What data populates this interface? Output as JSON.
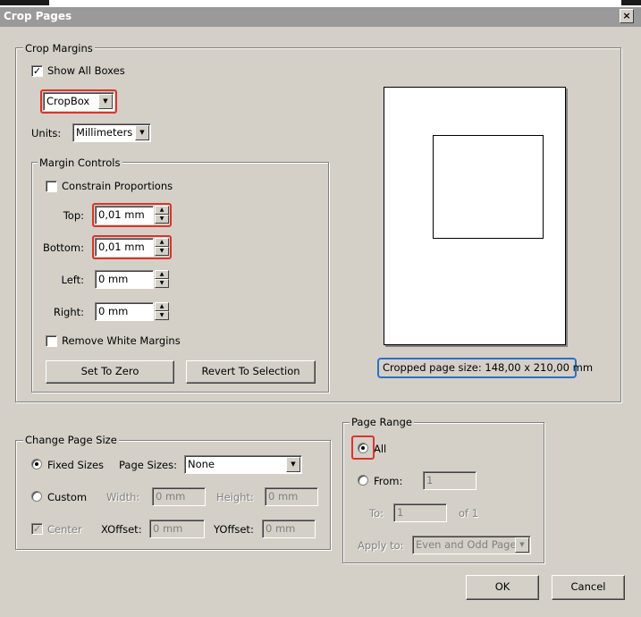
{
  "window": {
    "title": "Crop Pages",
    "close_glyph": "×"
  },
  "crop_margins": {
    "legend": "Crop Margins",
    "show_all_boxes": {
      "label": "Show All Boxes",
      "checked": true
    },
    "box_select": "CropBox",
    "units_label": "Units:",
    "units_value": "Millimeters",
    "margin_controls": {
      "legend": "Margin Controls",
      "constrain": {
        "label": "Constrain Proportions",
        "checked": false
      },
      "top_label": "Top:",
      "top_value": "0,01 mm",
      "bottom_label": "Bottom:",
      "bottom_value": "0,01 mm",
      "left_label": "Left:",
      "left_value": "0 mm",
      "right_label": "Right:",
      "right_value": "0 mm",
      "remove_white": {
        "label": "Remove White Margins",
        "checked": false
      },
      "set_to_zero": "Set To Zero",
      "revert": "Revert To Selection"
    },
    "cropped_size": "Cropped page size: 148,00 x 210,00 mm"
  },
  "change_page_size": {
    "legend": "Change Page Size",
    "fixed_sizes": "Fixed Sizes",
    "page_sizes_label": "Page Sizes:",
    "page_sizes_value": "None",
    "custom": "Custom",
    "width_label": "Width:",
    "width_value": "0 mm",
    "height_label": "Height:",
    "height_value": "0 mm",
    "center": "Center",
    "xoffset_label": "XOffset:",
    "xoffset_value": "0 mm",
    "yoffset_label": "YOffset:",
    "yoffset_value": "0 mm"
  },
  "page_range": {
    "legend": "Page Range",
    "all": "All",
    "from_label": "From:",
    "from_value": "1",
    "to_label": "To:",
    "to_value": "1",
    "of_label": "of 1",
    "apply_label": "Apply to:",
    "apply_value": "Even and Odd Pages"
  },
  "buttons": {
    "ok": "OK",
    "cancel": "Cancel"
  },
  "colors": {
    "dialog_bg": "#d4d0c8",
    "highlight_red": "#d9352c",
    "highlight_blue": "#2f6fc4"
  }
}
